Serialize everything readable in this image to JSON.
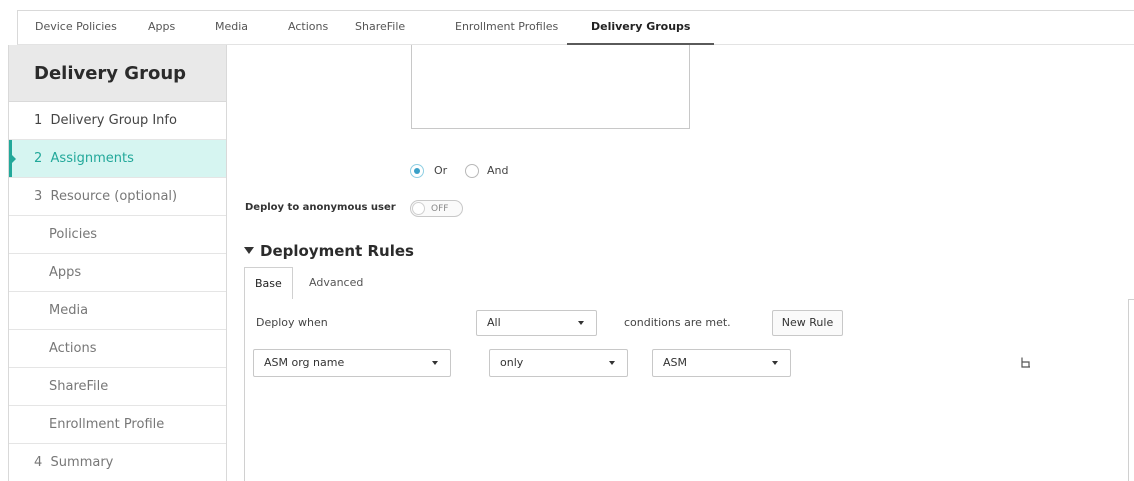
{
  "topnav": {
    "tabs": [
      {
        "label": "Device Policies"
      },
      {
        "label": "Apps"
      },
      {
        "label": "Media"
      },
      {
        "label": "Actions"
      },
      {
        "label": "ShareFile"
      },
      {
        "label": "Enrollment Profiles"
      },
      {
        "label": "Delivery Groups",
        "active": true
      }
    ]
  },
  "sidebar": {
    "title": "Delivery Group",
    "items": [
      {
        "label": "1  Delivery Group Info"
      },
      {
        "label": "2  Assignments",
        "active": true
      },
      {
        "label": "3  Resource (optional)"
      },
      {
        "label": "Policies"
      },
      {
        "label": "Apps"
      },
      {
        "label": "Media"
      },
      {
        "label": "Actions"
      },
      {
        "label": "ShareFile"
      },
      {
        "label": "Enrollment Profile"
      },
      {
        "label": "4  Summary"
      }
    ]
  },
  "match": {
    "or_label": "Or",
    "and_label": "And",
    "selected": "Or"
  },
  "anonymous": {
    "label": "Deploy to anonymous user",
    "toggle_text": "OFF"
  },
  "deployment_rules": {
    "title": "Deployment Rules",
    "tabs": [
      {
        "label": "Base",
        "active": true
      },
      {
        "label": "Advanced"
      }
    ],
    "deploy_when_label": "Deploy when",
    "condition_select": "All",
    "conditions_text": "conditions are met.",
    "new_rule_button": "New Rule",
    "rule": {
      "field": "ASM org name",
      "operator": "only",
      "value": "ASM"
    }
  },
  "colors": {
    "accent": "#22a89a",
    "active_bg": "#d6f5f1",
    "radio": "#3aa0c8"
  }
}
